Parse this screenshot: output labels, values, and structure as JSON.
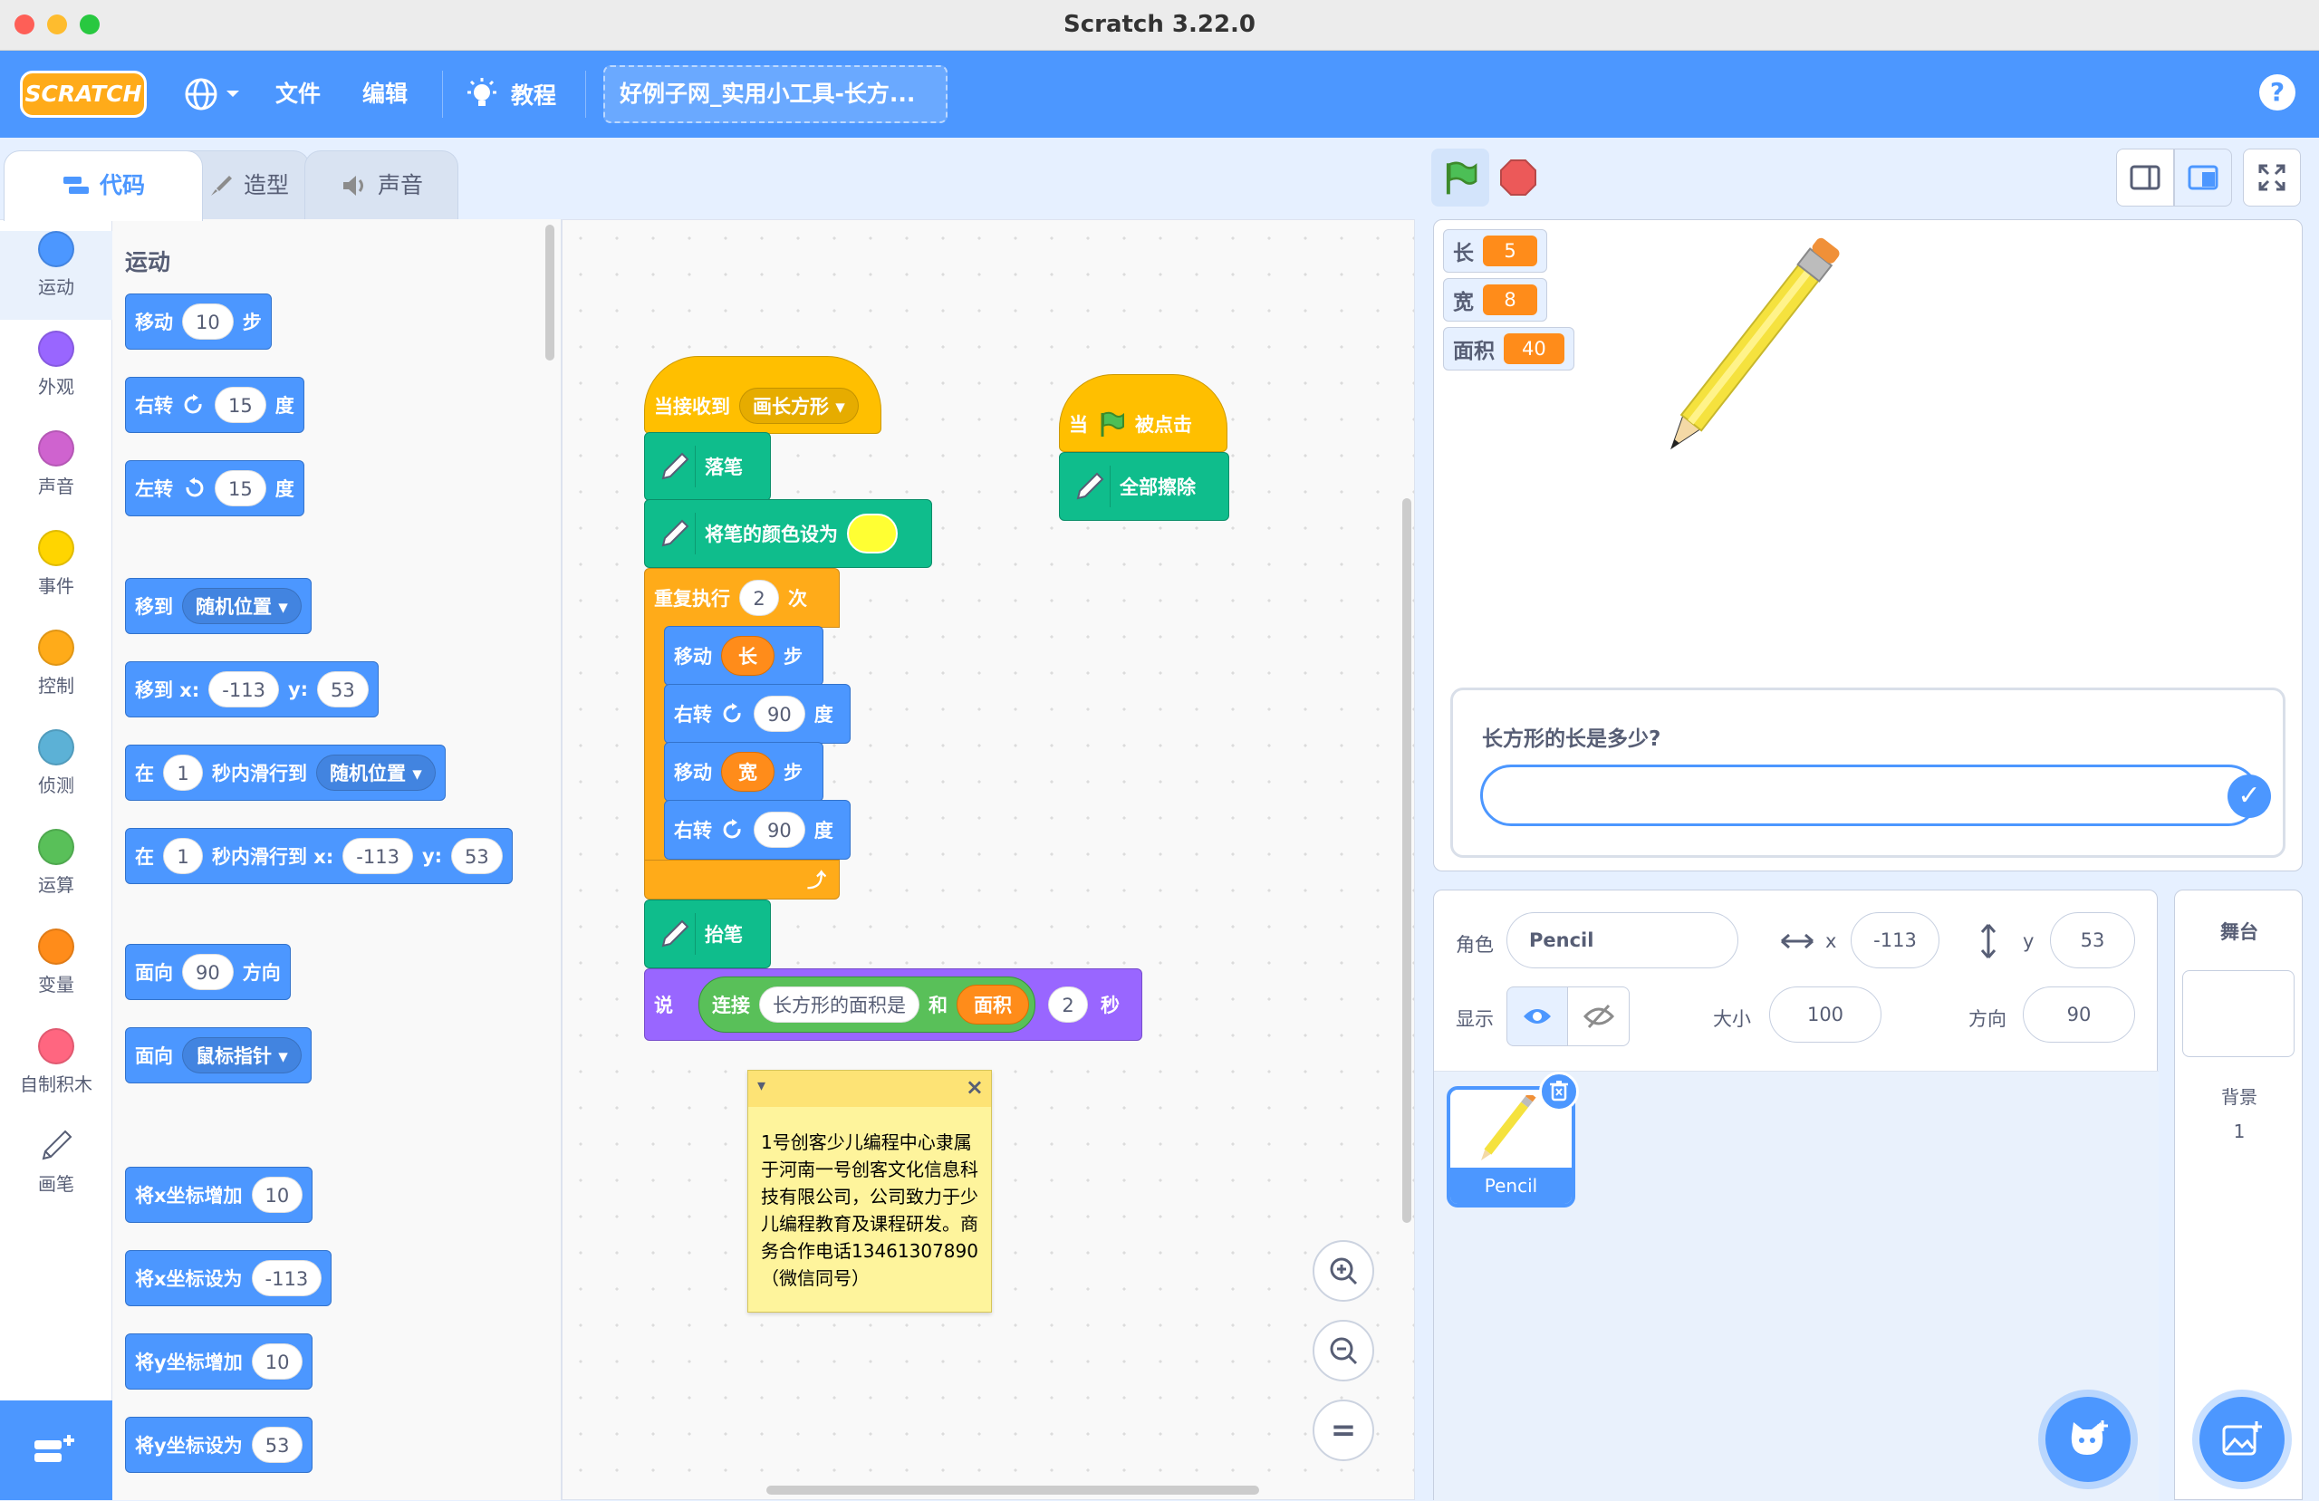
{
  "window": {
    "title": "Scratch 3.22.0"
  },
  "menu": {
    "logo": "SCRATCH",
    "file": "文件",
    "edit": "编辑",
    "tutorials": "教程",
    "project_title": "好例子网_实用小工具-长方...",
    "help": "?"
  },
  "tabs": {
    "code": "代码",
    "costumes": "造型",
    "sounds": "声音"
  },
  "categories": [
    {
      "label": "运动",
      "color": "#4c97ff"
    },
    {
      "label": "外观",
      "color": "#9966ff"
    },
    {
      "label": "声音",
      "color": "#cf63cf"
    },
    {
      "label": "事件",
      "color": "#ffd500"
    },
    {
      "label": "控制",
      "color": "#ffab19"
    },
    {
      "label": "侦测",
      "color": "#5cb1d6"
    },
    {
      "label": "运算",
      "color": "#59c059"
    },
    {
      "label": "变量",
      "color": "#ff8c1a"
    },
    {
      "label": "自制积木",
      "color": "#ff6680"
    },
    {
      "label": "画笔",
      "color": "pen"
    }
  ],
  "palette": {
    "heading": "运动",
    "move": {
      "a": "移动",
      "n": "10",
      "b": "步"
    },
    "turn_right": {
      "a": "右转",
      "n": "15",
      "b": "度"
    },
    "turn_left": {
      "a": "左转",
      "n": "15",
      "b": "度"
    },
    "goto": {
      "a": "移到",
      "d": "随机位置"
    },
    "goto_xy": {
      "a": "移到 x:",
      "x": "-113",
      "yl": "y:",
      "y": "53"
    },
    "glide": {
      "a": "在",
      "n": "1",
      "b": "秒内滑行到",
      "d": "随机位置"
    },
    "glide_xy": {
      "a": "在",
      "n": "1",
      "b": "秒内滑行到 x:",
      "x": "-113",
      "yl": "y:",
      "y": "53"
    },
    "point_dir": {
      "a": "面向",
      "n": "90",
      "b": "方向"
    },
    "point_to": {
      "a": "面向",
      "d": "鼠标指针"
    },
    "change_x": {
      "a": "将x坐标增加",
      "n": "10"
    },
    "set_x": {
      "a": "将x坐标设为",
      "n": "-113"
    },
    "change_y": {
      "a": "将y坐标增加",
      "n": "10"
    },
    "set_y": {
      "a": "将y坐标设为",
      "n": "53"
    }
  },
  "script": {
    "hat1": {
      "a": "当接收到",
      "d": "画长方形"
    },
    "pen_down": "落笔",
    "set_color": "将笔的颜色设为",
    "repeat": {
      "a": "重复执行",
      "n": "2",
      "b": "次"
    },
    "move1": {
      "a": "移动",
      "v": "长",
      "b": "步"
    },
    "turn1": {
      "a": "右转",
      "n": "90",
      "b": "度"
    },
    "move2": {
      "a": "移动",
      "v": "宽",
      "b": "步"
    },
    "turn2": {
      "a": "右转",
      "n": "90",
      "b": "度"
    },
    "repeat_end": "⤴",
    "pen_up": "抬笔",
    "say": {
      "a": "说",
      "join": "连接",
      "s": "长方形的面积是",
      "and": "和",
      "v": "面积",
      "n": "2",
      "b": "秒"
    },
    "hat2": {
      "a": "当",
      "b": "被点击"
    },
    "clear": "全部擦除",
    "note": "1号创客少儿编程中心隶属于河南一号创客文化信息科技有限公司，公司致力于少儿编程教育及课程研发。商务合作电话13461307890（微信同号）",
    "zoom_reset": "="
  },
  "stage": {
    "monitors": [
      {
        "label": "长",
        "value": "5"
      },
      {
        "label": "宽",
        "value": "8"
      },
      {
        "label": "面积",
        "value": "40"
      }
    ],
    "ask_question": "长方形的长是多少?",
    "ask_answer": "",
    "ask_ok": "✓"
  },
  "sprite": {
    "label_sprite": "角色",
    "name": "Pencil",
    "x_label": "x",
    "x": "-113",
    "y_label": "y",
    "y": "53",
    "show_label": "显示",
    "size_label": "大小",
    "size": "100",
    "dir_label": "方向",
    "direction": "90",
    "tile_name": "Pencil"
  },
  "stage_panel": {
    "title": "舞台",
    "backdrops_label": "背景",
    "backdrops_count": "1"
  }
}
